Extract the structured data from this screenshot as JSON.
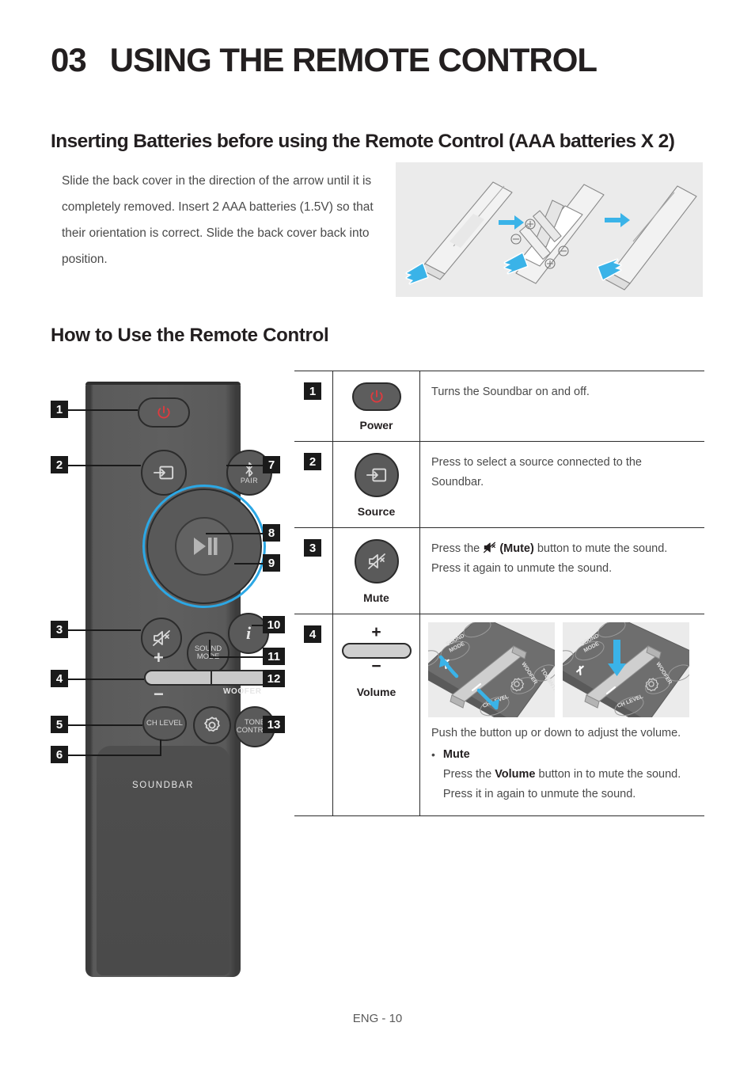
{
  "chapter": {
    "number": "03",
    "title": "USING THE REMOTE CONTROL"
  },
  "sections": {
    "batteries": {
      "heading": "Inserting Batteries before using the Remote Control (AAA batteries X 2)",
      "body": "Slide the back cover in the direction of the arrow until it is completely removed. Insert 2 AAA batteries (1.5V) so that their orientation is correct. Slide the back cover back into position."
    },
    "howto": {
      "heading": "How to Use the Remote Control"
    }
  },
  "remote": {
    "model_label": "SOUNDBAR",
    "buttons": {
      "power": "",
      "source": "",
      "pair": "PAIR",
      "play_pause": "",
      "mute": "",
      "info": "",
      "sound_mode": "SOUND MODE",
      "ch_level": "CH LEVEL",
      "settings": "",
      "tone_control": "TONE CONTROL",
      "woofer": "WOOFER",
      "volume_plus": "+",
      "volume_minus": "−"
    },
    "callouts_left": [
      "1",
      "2",
      "3",
      "4",
      "5",
      "6"
    ],
    "callouts_right": [
      "7",
      "8",
      "9",
      "10",
      "11",
      "12",
      "13"
    ]
  },
  "table": {
    "rows": [
      {
        "no": "1",
        "button_label": "Power",
        "icon": "power-icon",
        "description": "Turns the Soundbar on and off."
      },
      {
        "no": "2",
        "button_label": "Source",
        "icon": "source-icon",
        "description": "Press to select a source connected to the Soundbar."
      },
      {
        "no": "3",
        "button_label": "Mute",
        "icon": "mute-icon",
        "desc_pre": "Press the ",
        "desc_bold": "(Mute)",
        "desc_post": " button to mute the sound. Press it again to unmute the sound."
      },
      {
        "no": "4",
        "button_label": "Volume",
        "icon": "volume-rocker-icon",
        "plus": "+",
        "minus": "−",
        "note_main": "Push the button up or down to adjust the volume.",
        "bullet_title": "Mute",
        "bullet_pre": "Press the ",
        "bullet_bold": "Volume",
        "bullet_post": " button in to mute the sound. Press it in again to unmute the sound."
      }
    ]
  },
  "illustration_labels": {
    "sound_mode": "SOUND MODE",
    "woofer": "WOOFER",
    "tone_control": "TONE CONTROL",
    "ch_level": "CH LEVEL"
  },
  "footer": {
    "page": "ENG - 10"
  },
  "colors": {
    "accent_blue": "#2ca7e4",
    "power_red": "#e03a3e",
    "illustration_bg": "#ebebeb",
    "remote_body": "#5a5a5a",
    "ink": "#231f20"
  }
}
